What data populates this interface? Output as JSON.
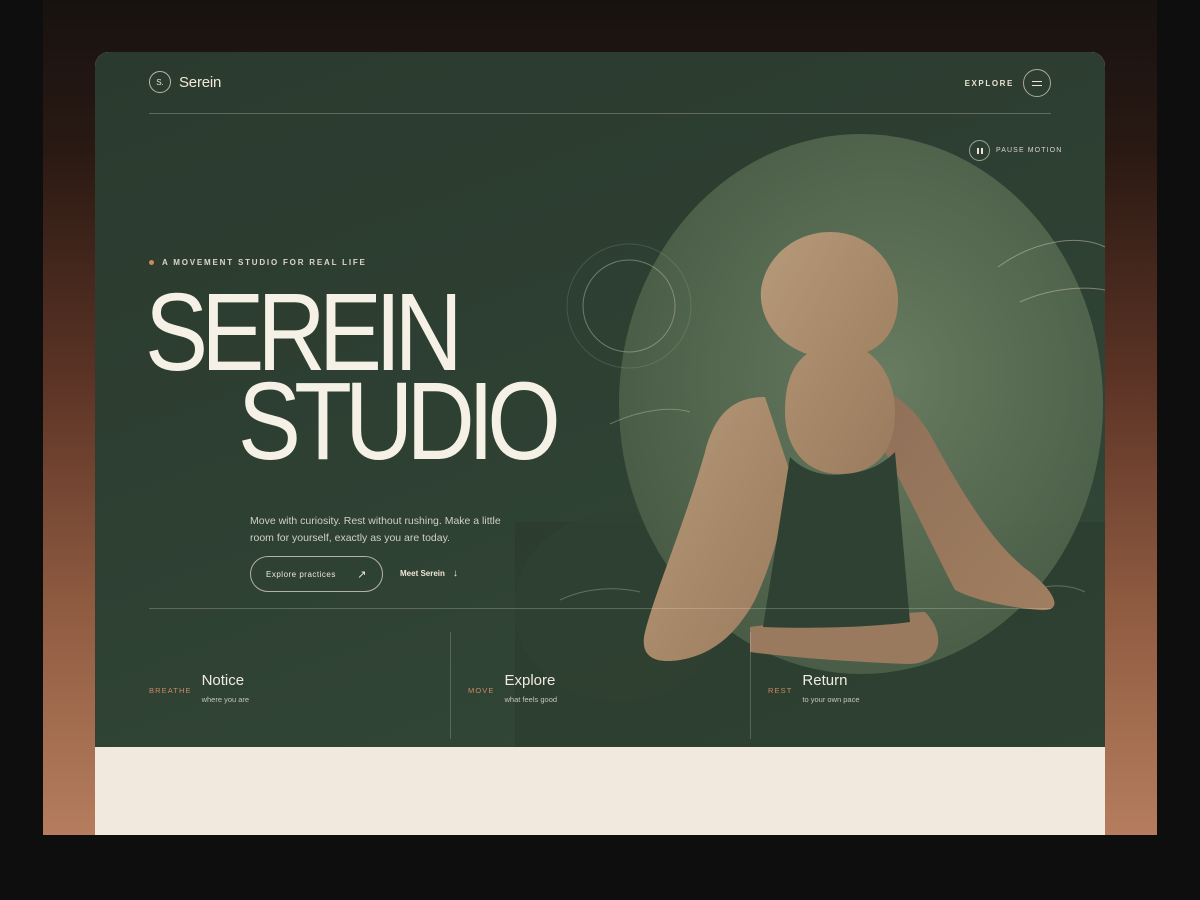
{
  "colors": {
    "hero_bg": "#2e4133",
    "accent": "#c88a62",
    "figure": "#b49576",
    "cream": "#f1e9de"
  },
  "nav": {
    "brand_mark": "S.",
    "brand_name": "Serein",
    "explore_label": "EXPLORE",
    "menu_icon": "hamburger-icon"
  },
  "motion": {
    "pause_label": "PAUSE MOTION",
    "pause_icon": "pause-icon"
  },
  "hero": {
    "eyebrow": "A MOVEMENT STUDIO FOR REAL LIFE",
    "headline_line1": "SEREIN",
    "headline_line2": "STUDIO",
    "lede": "Move with curiosity. Rest without rushing. Make a little room for yourself, exactly as you are today.",
    "primary_cta": "Explore practices",
    "primary_cta_icon": "arrow-up-right-icon",
    "secondary_cta": "Meet Serein",
    "secondary_cta_icon": "arrow-down-icon"
  },
  "pillars": [
    {
      "tag": "BREATHE",
      "title": "Notice",
      "subtitle": "where you are"
    },
    {
      "tag": "MOVE",
      "title": "Explore",
      "subtitle": "what feels good"
    },
    {
      "tag": "REST",
      "title": "Return",
      "subtitle": "to your own pace"
    }
  ]
}
